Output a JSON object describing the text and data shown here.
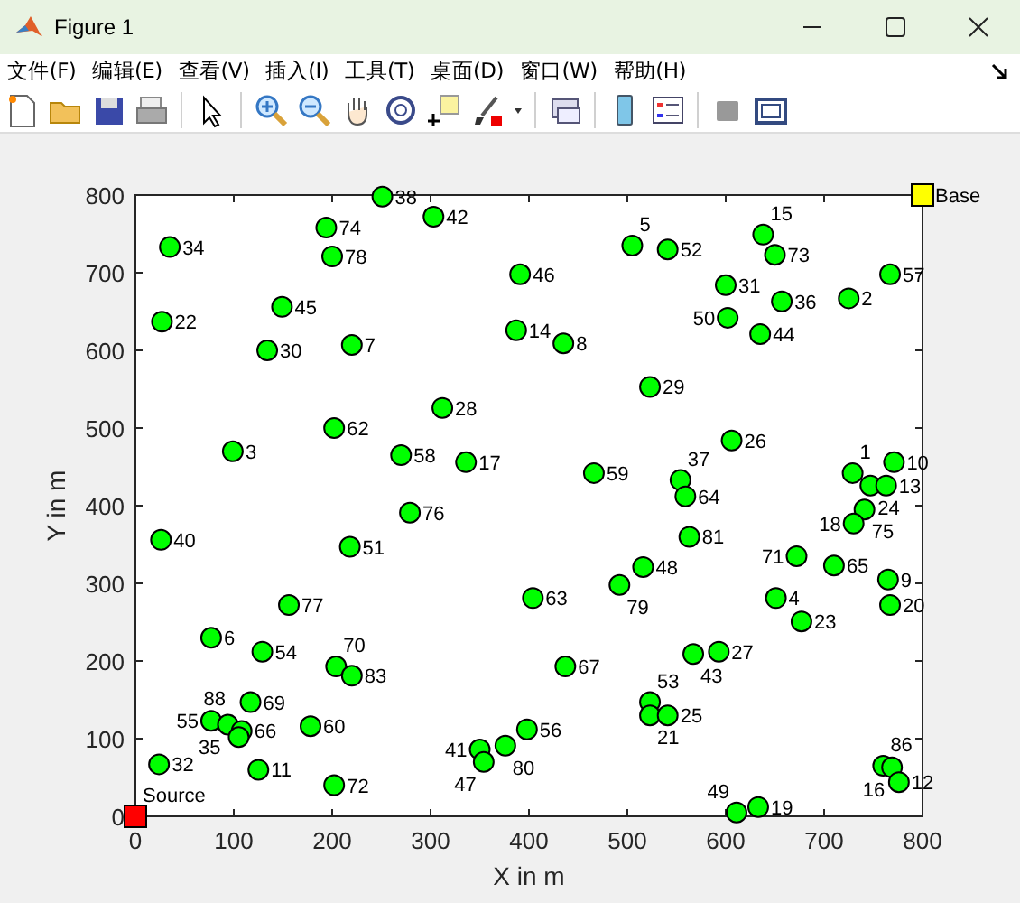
{
  "window": {
    "title": "Figure 1"
  },
  "menu": [
    "文件(F)",
    "编辑(E)",
    "查看(V)",
    "插入(I)",
    "工具(T)",
    "桌面(D)",
    "窗口(W)",
    "帮助(H)"
  ],
  "toolbar": [
    {
      "kind": "new"
    },
    {
      "kind": "open"
    },
    {
      "kind": "save"
    },
    {
      "kind": "print"
    },
    {
      "kind": "sep"
    },
    {
      "kind": "pointer"
    },
    {
      "kind": "sep"
    },
    {
      "kind": "zoomin"
    },
    {
      "kind": "zoomout"
    },
    {
      "kind": "pan"
    },
    {
      "kind": "rotate"
    },
    {
      "kind": "datatip"
    },
    {
      "kind": "brush"
    },
    {
      "kind": "sep"
    },
    {
      "kind": "link"
    },
    {
      "kind": "sep"
    },
    {
      "kind": "colorbar"
    },
    {
      "kind": "legend"
    },
    {
      "kind": "sep"
    },
    {
      "kind": "hide"
    },
    {
      "kind": "show"
    }
  ],
  "axes": {
    "chart_data": {
      "type": "scatter",
      "xlabel": "X in m",
      "ylabel": "Y in m",
      "xlim": [
        0,
        800
      ],
      "ylim": [
        0,
        800
      ],
      "xticks": [
        0,
        100,
        200,
        300,
        400,
        500,
        600,
        700,
        800
      ],
      "yticks": [
        0,
        100,
        200,
        300,
        400,
        500,
        600,
        700,
        800
      ],
      "series": [
        {
          "color": "#00ff00",
          "x": [
            251,
            303,
            194,
            200,
            35,
            149,
            27,
            134,
            220,
            391,
            387,
            312,
            202,
            99,
            270,
            336,
            505,
            541,
            638,
            650,
            600,
            657,
            602,
            635,
            725,
            767,
            435,
            523,
            606,
            466,
            554,
            559,
            729,
            747,
            763,
            771,
            741,
            730,
            672,
            710,
            765,
            767,
            651,
            677,
            563,
            516,
            492,
            404,
            437,
            567,
            593,
            523,
            523,
            541,
            398,
            611,
            633,
            760,
            769,
            776,
            279,
            26,
            218,
            156,
            77,
            129,
            204,
            220,
            117,
            178,
            77,
            94,
            108,
            105,
            24,
            125,
            202,
            350,
            376,
            354
          ],
          "values": [
            798,
            772,
            758,
            721,
            733,
            656,
            637,
            600,
            607,
            698,
            626,
            526,
            500,
            470,
            465,
            456,
            735,
            730,
            749,
            723,
            684,
            663,
            642,
            621,
            667,
            698,
            609,
            553,
            484,
            442,
            433,
            412,
            442,
            426,
            426,
            456,
            395,
            377,
            335,
            323,
            305,
            272,
            281,
            251,
            360,
            321,
            298,
            281,
            193,
            209,
            212,
            147,
            130,
            130,
            112,
            5,
            12,
            65,
            63,
            44,
            391,
            356,
            347,
            272,
            230,
            212,
            193,
            181,
            147,
            116,
            123,
            118,
            110,
            102,
            67,
            60,
            40,
            86,
            91,
            70
          ]
        },
        {
          "color": "#ff0000",
          "x": [
            0
          ],
          "values": [
            0
          ]
        },
        {
          "color": "#ffff00",
          "x": [
            800
          ],
          "values": [
            800
          ]
        }
      ],
      "annotations": [
        {
          "text": "38",
          "x": 251,
          "y": 798
        },
        {
          "text": "42",
          "x": 303,
          "y": 772
        },
        {
          "text": "74",
          "x": 194,
          "y": 758
        },
        {
          "text": "78",
          "x": 200,
          "y": 721
        },
        {
          "text": "34",
          "x": 35,
          "y": 733
        },
        {
          "text": "45",
          "x": 149,
          "y": 656
        },
        {
          "text": "22",
          "x": 27,
          "y": 637
        },
        {
          "text": "30",
          "x": 134,
          "y": 600
        },
        {
          "text": "7",
          "x": 220,
          "y": 607
        },
        {
          "text": "46",
          "x": 391,
          "y": 698
        },
        {
          "text": "14",
          "x": 387,
          "y": 626
        },
        {
          "text": "28",
          "x": 312,
          "y": 526
        },
        {
          "text": "62",
          "x": 202,
          "y": 500
        },
        {
          "text": "3",
          "x": 99,
          "y": 470
        },
        {
          "text": "58",
          "x": 270,
          "y": 465
        },
        {
          "text": "17",
          "x": 336,
          "y": 456
        },
        {
          "text": "5",
          "x": 505,
          "y": 735
        },
        {
          "text": "52",
          "x": 541,
          "y": 730
        },
        {
          "text": "15",
          "x": 638,
          "y": 749
        },
        {
          "text": "73",
          "x": 650,
          "y": 723
        },
        {
          "text": "31",
          "x": 600,
          "y": 684
        },
        {
          "text": "36",
          "x": 657,
          "y": 663
        },
        {
          "text": "50",
          "x": 602,
          "y": 642
        },
        {
          "text": "44",
          "x": 635,
          "y": 621
        },
        {
          "text": "2",
          "x": 725,
          "y": 667
        },
        {
          "text": "57",
          "x": 767,
          "y": 698
        },
        {
          "text": "8",
          "x": 435,
          "y": 609
        },
        {
          "text": "29",
          "x": 523,
          "y": 553
        },
        {
          "text": "26",
          "x": 606,
          "y": 484
        },
        {
          "text": "59",
          "x": 466,
          "y": 442
        },
        {
          "text": "37",
          "x": 554,
          "y": 433
        },
        {
          "text": "64",
          "x": 559,
          "y": 412
        },
        {
          "text": "1",
          "x": 729,
          "y": 442
        },
        {
          "text": "24",
          "x": 747,
          "y": 426
        },
        {
          "text": "13",
          "x": 763,
          "y": 426
        },
        {
          "text": "10",
          "x": 771,
          "y": 456
        },
        {
          "text": "75",
          "x": 741,
          "y": 395
        },
        {
          "text": "18",
          "x": 730,
          "y": 377
        },
        {
          "text": "71",
          "x": 672,
          "y": 335
        },
        {
          "text": "65",
          "x": 710,
          "y": 323
        },
        {
          "text": "9",
          "x": 765,
          "y": 305
        },
        {
          "text": "20",
          "x": 767,
          "y": 272
        },
        {
          "text": "4",
          "x": 651,
          "y": 281
        },
        {
          "text": "23",
          "x": 677,
          "y": 251
        },
        {
          "text": "81",
          "x": 563,
          "y": 360
        },
        {
          "text": "48",
          "x": 516,
          "y": 321
        },
        {
          "text": "79",
          "x": 492,
          "y": 298
        },
        {
          "text": "63",
          "x": 404,
          "y": 281
        },
        {
          "text": "67",
          "x": 437,
          "y": 193
        },
        {
          "text": "43",
          "x": 567,
          "y": 209
        },
        {
          "text": "27",
          "x": 593,
          "y": 212
        },
        {
          "text": "53",
          "x": 523,
          "y": 147
        },
        {
          "text": "21",
          "x": 523,
          "y": 130
        },
        {
          "text": "25",
          "x": 541,
          "y": 130
        },
        {
          "text": "56",
          "x": 398,
          "y": 112
        },
        {
          "text": "49",
          "x": 611,
          "y": 5
        },
        {
          "text": "19",
          "x": 633,
          "y": 12
        },
        {
          "text": "86",
          "x": 760,
          "y": 65
        },
        {
          "text": "16",
          "x": 769,
          "y": 63
        },
        {
          "text": "12",
          "x": 776,
          "y": 44
        },
        {
          "text": "76",
          "x": 279,
          "y": 391
        },
        {
          "text": "40",
          "x": 26,
          "y": 356
        },
        {
          "text": "51",
          "x": 218,
          "y": 347
        },
        {
          "text": "77",
          "x": 156,
          "y": 272
        },
        {
          "text": "6",
          "x": 77,
          "y": 230
        },
        {
          "text": "54",
          "x": 129,
          "y": 212
        },
        {
          "text": "70",
          "x": 204,
          "y": 193
        },
        {
          "text": "83",
          "x": 220,
          "y": 181
        },
        {
          "text": "69",
          "x": 117,
          "y": 147
        },
        {
          "text": "60",
          "x": 178,
          "y": 116
        },
        {
          "text": "55",
          "x": 77,
          "y": 123
        },
        {
          "text": "35",
          "x": 94,
          "y": 118
        },
        {
          "text": "66",
          "x": 108,
          "y": 110
        },
        {
          "text": "88",
          "x": 105,
          "y": 102
        },
        {
          "text": "32",
          "x": 24,
          "y": 67
        },
        {
          "text": "11",
          "x": 125,
          "y": 60
        },
        {
          "text": "72",
          "x": 202,
          "y": 40
        },
        {
          "text": "41",
          "x": 350,
          "y": 86
        },
        {
          "text": "80",
          "x": 376,
          "y": 91
        },
        {
          "text": "47",
          "x": 354,
          "y": 70
        },
        {
          "text": "Source",
          "x": 0,
          "y": 0
        },
        {
          "text": "Base",
          "x": 800,
          "y": 800
        }
      ]
    }
  }
}
